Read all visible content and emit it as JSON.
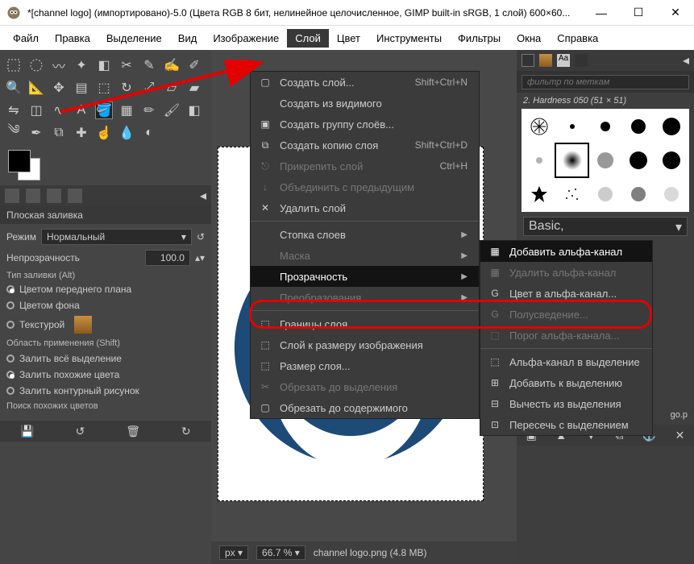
{
  "window": {
    "title": "*[channel logo] (импортировано)-5.0 (Цвета RGB 8 бит, нелинейное целочисленное, GIMP built-in sRGB, 1 слой) 600×60..."
  },
  "menubar": {
    "items": [
      "Файл",
      "Правка",
      "Выделение",
      "Вид",
      "Изображение",
      "Слой",
      "Цвет",
      "Инструменты",
      "Фильтры",
      "Окна",
      "Справка"
    ],
    "active_index": 5
  },
  "layer_menu": [
    {
      "icon": "▢",
      "label": "Создать слой...",
      "accel": "Shift+Ctrl+N"
    },
    {
      "icon": "",
      "label": "Создать из видимого"
    },
    {
      "icon": "▣",
      "label": "Создать группу слоёв..."
    },
    {
      "icon": "⧉",
      "label": "Создать копию слоя",
      "accel": "Shift+Ctrl+D"
    },
    {
      "icon": "⎋",
      "label": "Прикрепить слой",
      "accel": "Ctrl+H",
      "disabled": true
    },
    {
      "icon": "↓",
      "label": "Объединить с предыдущим",
      "disabled": true
    },
    {
      "icon": "✕",
      "label": "Удалить слой"
    },
    {
      "sep": true
    },
    {
      "icon": "",
      "label": "Стопка слоев",
      "sub": true
    },
    {
      "icon": "",
      "label": "Маска",
      "sub": true,
      "disabled": true
    },
    {
      "icon": "",
      "label": "Прозрачность",
      "sub": true,
      "hl": true
    },
    {
      "icon": "",
      "label": "Преобразования",
      "sub": true,
      "disabled": true
    },
    {
      "sep": true
    },
    {
      "icon": "⬚",
      "label": "Границы слоя..."
    },
    {
      "icon": "⬚",
      "label": "Слой к размеру изображения"
    },
    {
      "icon": "⬚",
      "label": "Размер слоя..."
    },
    {
      "icon": "✂",
      "label": "Обрезать до выделения",
      "disabled": true
    },
    {
      "icon": "▢",
      "label": "Обрезать до содержимого"
    }
  ],
  "transparency_menu": [
    {
      "icon": "▦",
      "label": "Добавить альфа-канал",
      "hl": true
    },
    {
      "icon": "▦",
      "label": "Удалить альфа-канал",
      "disabled": true
    },
    {
      "icon": "G",
      "label": "Цвет в альфа-канал..."
    },
    {
      "icon": "G",
      "label": "Полусведение...",
      "disabled": true
    },
    {
      "icon": "⬚",
      "label": "Порог альфа-канала...",
      "disabled": true
    },
    {
      "sep": true
    },
    {
      "icon": "⬚",
      "label": "Альфа-канал в выделение"
    },
    {
      "icon": "⊞",
      "label": "Добавить к выделению"
    },
    {
      "icon": "⊟",
      "label": "Вычесть из выделения"
    },
    {
      "icon": "⊡",
      "label": "Пересечь с выделением"
    }
  ],
  "toolopts": {
    "title": "Плоская заливка",
    "mode_label": "Режим",
    "mode_value": "Нормальный",
    "opacity_label": "Непрозрачность",
    "opacity_value": "100.0",
    "fill_type_title": "Тип заливки (Alt)",
    "fill_fg": "Цветом переднего плана",
    "fill_bg": "Цветом фона",
    "fill_pattern": "Текстурой",
    "scope_title": "Область применения (Shift)",
    "scope_all": "Залить всё выделение",
    "scope_similar": "Залить похожие цвета",
    "scope_edge": "Залить контурный рисунок",
    "find_title": "Поиск похожих цветов"
  },
  "right": {
    "filter_placeholder": "фильтр по меткам",
    "brush_name": "2. Hardness 050 (51 × 51)",
    "preset": "Basic,",
    "layer_file": "go.p"
  },
  "status": {
    "unit": "px",
    "zoom": "66.7 %",
    "file": "channel logo.png (4.8 MB)"
  }
}
